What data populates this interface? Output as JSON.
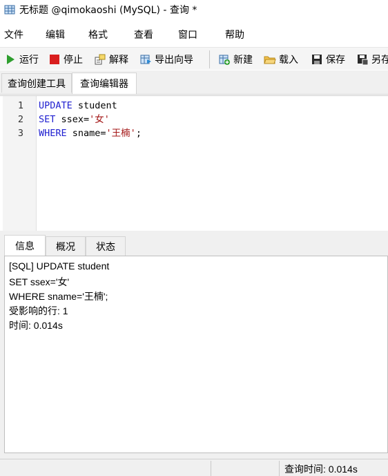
{
  "window": {
    "title": "无标题 @qimokaoshi (MySQL) - 查询 *",
    "icon": "table-grid-icon"
  },
  "menu": {
    "items": [
      "文件",
      "编辑",
      "格式",
      "查看",
      "窗口",
      "帮助"
    ]
  },
  "toolbar": {
    "run": {
      "label": "运行",
      "icon": "play-icon"
    },
    "stop": {
      "label": "停止",
      "icon": "stop-icon"
    },
    "explain": {
      "label": "解释",
      "icon": "explain-icon"
    },
    "export_wizard": {
      "label": "导出向导",
      "icon": "export-icon"
    },
    "new": {
      "label": "新建",
      "icon": "new-query-icon"
    },
    "load": {
      "label": "载入",
      "icon": "folder-open-icon"
    },
    "save": {
      "label": "保存",
      "icon": "save-icon"
    },
    "save_as": {
      "label": "另存",
      "icon": "save-as-icon"
    }
  },
  "top_tabs": [
    {
      "label": "查询创建工具",
      "active": false
    },
    {
      "label": "查询编辑器",
      "active": true
    }
  ],
  "editor": {
    "lines": [
      {
        "number": "1",
        "keyword": "UPDATE",
        "rest": " student",
        "string": "",
        "tail": ""
      },
      {
        "number": "2",
        "keyword": "SET",
        "rest": " ssex=",
        "string": "'女'",
        "tail": ""
      },
      {
        "number": "3",
        "keyword": "WHERE",
        "rest": " sname=",
        "string": "'王楠'",
        "tail": ";"
      }
    ]
  },
  "result_tabs": [
    {
      "label": "信息",
      "active": true
    },
    {
      "label": "概况",
      "active": false
    },
    {
      "label": "状态",
      "active": false
    }
  ],
  "info": {
    "lines": [
      "[SQL] UPDATE student",
      "SET ssex='女'",
      "WHERE sname='王楠';",
      "受影响的行: 1",
      "时间: 0.014s"
    ]
  },
  "status": {
    "query_time": "查询时间: 0.014s"
  },
  "colors": {
    "keyword": "#1f1fd0",
    "string": "#a31515",
    "run_green": "#2e9e2e",
    "stop_red": "#d91e1e"
  }
}
